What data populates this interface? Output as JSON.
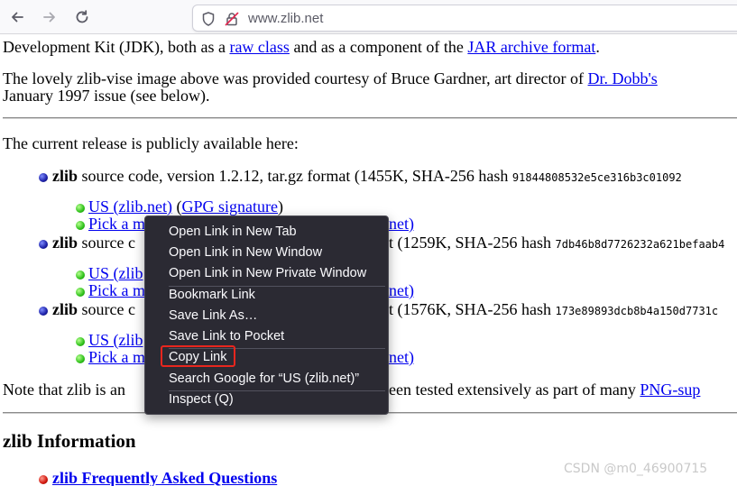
{
  "browser": {
    "url": "www.zlib.net",
    "back_icon": "arrow-left-icon",
    "forward_icon": "arrow-right-icon",
    "reload_icon": "reload-icon",
    "shield_icon": "shield-icon",
    "lock_icon": "insecure-lock-icon"
  },
  "page": {
    "line1": {
      "prefix": "Development Kit (JDK), both as a ",
      "link1": "raw class",
      "mid": " and as a component of the ",
      "link2": "JAR archive format",
      "suffix": "."
    },
    "line2": {
      "prefix": "The lovely zlib-vise image above was provided courtesy of Bruce Gardner, art director of ",
      "link": "Dr. Dobb's"
    },
    "line3": "January 1997 issue (see below).",
    "release_intro": "The current release is publicly available here:",
    "releases": [
      {
        "name": "zlib",
        "desc_visible": " source code, version 1.2.12, tar.gz format (1455K, SHA-256 hash ",
        "hash": "91844808532e5ce316b3c01092",
        "sub1_link": "US (zlib.net)",
        "sub1_sep": " (",
        "sub1_link2": "GPG signature",
        "sub1_end": ")",
        "sub2_link_left": "Pick a m",
        "sub2_link_right": "net)"
      },
      {
        "name": "zlib",
        "desc_left": " source c",
        "desc_right": "t (1259K, SHA-256 hash ",
        "hash": "7db46b8d7726232a621befaab4",
        "sub1_link_left": "US (zlib",
        "sub2_link_left": "Pick a m",
        "sub2_link_right": "net)"
      },
      {
        "name": "zlib",
        "desc_left": " source c",
        "desc_right": "t (1576K, SHA-256 hash ",
        "hash": "173e89893dcb8b4a150d7731c",
        "sub1_link_left": "US (zlib",
        "sub2_link_left": "Pick a m",
        "sub2_link_right": "net)"
      }
    ],
    "note": {
      "left": "Note that zlib is an ",
      "right": "een tested extensively as part of many ",
      "link": "PNG-sup"
    },
    "info_heading": "zlib Information",
    "faq_link": "zlib Frequently Asked Questions"
  },
  "context_menu": {
    "items": [
      {
        "label": "Open Link in New Tab"
      },
      {
        "label": "Open Link in New Window"
      },
      {
        "label": "Open Link in New Private Window"
      },
      {
        "label": "Bookmark Link"
      },
      {
        "label": "Save Link As…"
      },
      {
        "label": "Save Link to Pocket"
      },
      {
        "label": "Copy Link"
      },
      {
        "label": "Search Google for “US (zlib.net)”"
      },
      {
        "label": "Inspect (Q)"
      }
    ],
    "highlighted_item": "Copy Link",
    "highlight_color": "#e8261e"
  },
  "watermark": "CSDN @m0_46900715"
}
